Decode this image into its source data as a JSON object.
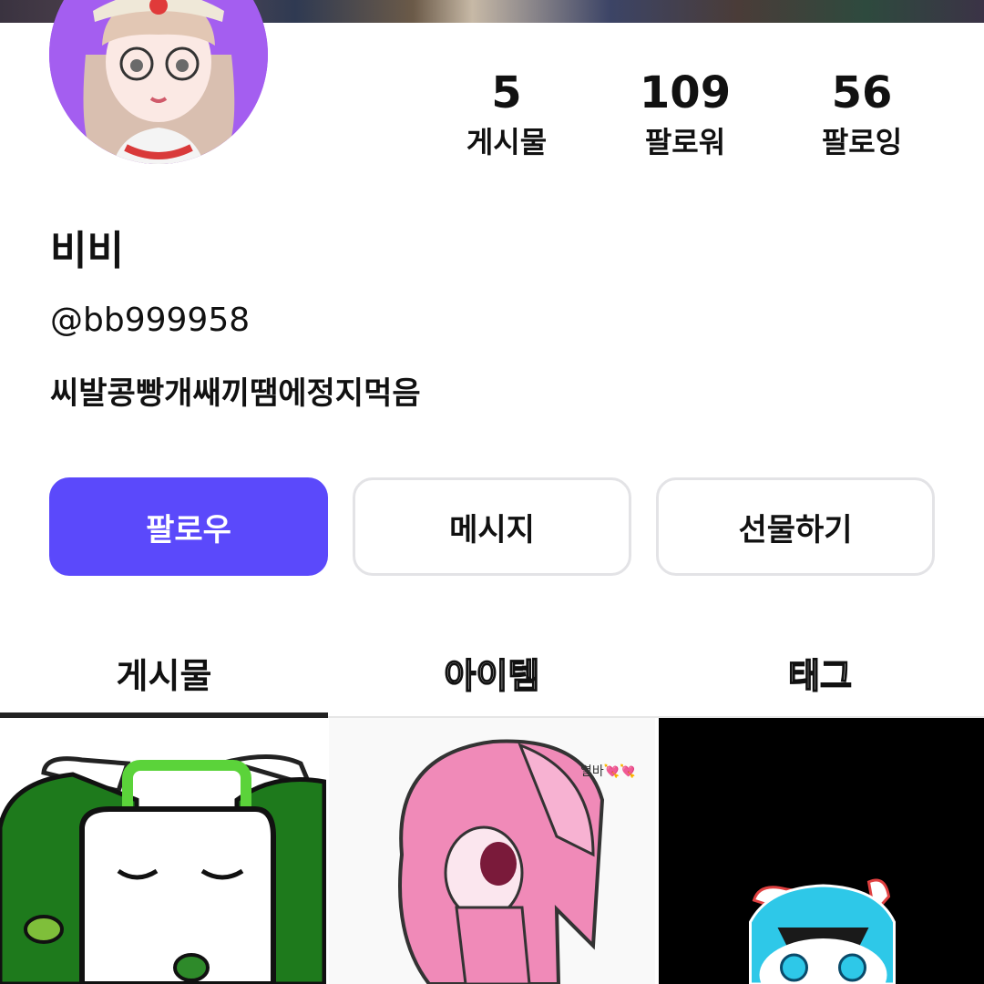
{
  "profile": {
    "display_name": "비비",
    "handle": "@bb999958",
    "bio": "씨발콩빵개쌔끼땜에정지먹음",
    "avatar_bg": "#a45ef0"
  },
  "stats": [
    {
      "value": "5",
      "label": "게시물"
    },
    {
      "value": "109",
      "label": "팔로워"
    },
    {
      "value": "56",
      "label": "팔로잉"
    }
  ],
  "actions": {
    "follow_label": "팔로우",
    "message_label": "메시지",
    "gift_label": "선물하기",
    "accent": "#5b49fb"
  },
  "tabs": [
    {
      "label": "게시물",
      "active": true
    },
    {
      "label": "아이템",
      "active": false
    },
    {
      "label": "태그",
      "active": false
    }
  ],
  "posts": [
    {
      "icon": "green-character-thumbnail"
    },
    {
      "icon": "pink-character-thumbnail",
      "caption": "열바💘💘"
    },
    {
      "icon": "cyan-character-thumbnail"
    }
  ]
}
